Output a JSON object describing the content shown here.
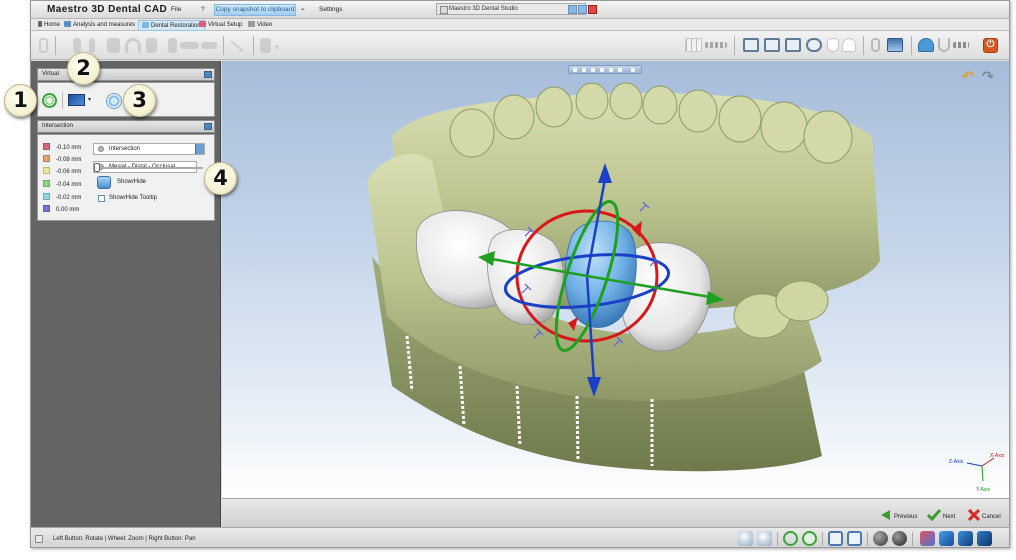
{
  "title_bar": {
    "app_title": "Maestro 3D Dental CAD",
    "menu_file": "File",
    "menu_help": "?",
    "snapshot_button": "Copy snapshot to clipboard",
    "snapshot_arrow": "⌄",
    "menu_settings": "Settings",
    "window_title": "Maestro 3D Dental Studio"
  },
  "tabs": [
    {
      "label": "Home"
    },
    {
      "label": "Analysis and measures"
    },
    {
      "label": "Dental Restoration",
      "active": true
    },
    {
      "label": "Virtual Setup"
    },
    {
      "label": "Video"
    }
  ],
  "left_panel": {
    "virtual_controls_header": "Virtual",
    "intersection_header": "Intersection",
    "legend": [
      {
        "value": "-0.10 mm",
        "color": "#d8677a"
      },
      {
        "value": "-0.08 mm",
        "color": "#e3a36d"
      },
      {
        "value": "-0.06 mm",
        "color": "#ece79c"
      },
      {
        "value": "-0.04 mm",
        "color": "#8cd47e"
      },
      {
        "value": "-0.02 mm",
        "color": "#8ed6e8"
      },
      {
        "value": "0.00 mm",
        "color": "#6f76d8"
      }
    ],
    "mode_select": "Intersection",
    "plane_select": "Mesial - Distal - Occlusal",
    "slider_value": 0,
    "show_hide_label": "Show/Hide",
    "show_hide_tooltip_label": "Show/Hide Tooltip",
    "show_hide_tooltip_checked": false
  },
  "callouts": [
    "1",
    "2",
    "3",
    "4"
  ],
  "viewport": {
    "axis_labels": {
      "x": "X-Axis",
      "y": "Y-Axis",
      "z": "Z-Axis"
    }
  },
  "nav": {
    "previous": "Previous",
    "next": "Next",
    "cancel": "Cancel"
  },
  "status_bar": {
    "hint": "Left Button: Rotate | Wheel: Zoom | Right Button: Pan"
  },
  "colors": {
    "accent": "#4a90d0",
    "gizmo_red": "#d81818",
    "gizmo_green": "#20a020",
    "gizmo_blue": "#1a40c8",
    "model_plaster": "#c7cf9e"
  }
}
